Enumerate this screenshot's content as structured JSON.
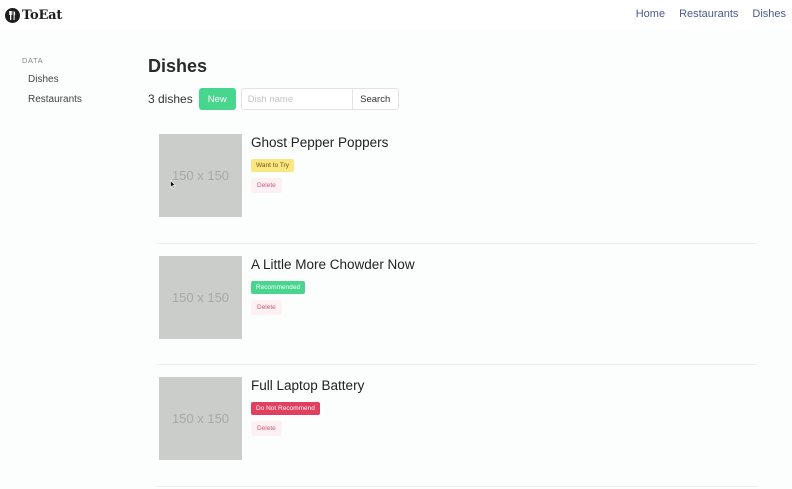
{
  "navbar": {
    "brand": "ToEat",
    "links": [
      "Home",
      "Restaurants",
      "Dishes"
    ]
  },
  "sidebar": {
    "label": "DATA",
    "items": [
      "Dishes",
      "Restaurants"
    ]
  },
  "main": {
    "title": "Dishes",
    "count_text": "3 dishes",
    "new_label": "New",
    "search": {
      "placeholder": "Dish name",
      "value": ""
    },
    "search_label": "Search"
  },
  "dishes": [
    {
      "image_text": "150 x 150",
      "name": "Ghost Pepper Poppers",
      "tag": "Want to Try",
      "tag_style": "want",
      "delete_label": "Delete"
    },
    {
      "image_text": "150 x 150",
      "name": "A Little More Chowder Now",
      "tag": "Recommended",
      "tag_style": "rec",
      "delete_label": "Delete"
    },
    {
      "image_text": "150 x 150",
      "name": "Full Laptop Battery",
      "tag": "Do Not Recommend",
      "tag_style": "not",
      "delete_label": "Delete"
    }
  ],
  "colors": {
    "accent": "#48d68e",
    "warning": "#fbe682",
    "danger": "#e23f5f",
    "nav_link": "#4a5a8e"
  }
}
